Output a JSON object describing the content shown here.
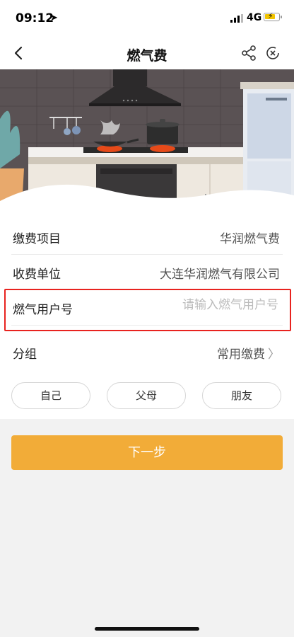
{
  "status": {
    "time": "09:12",
    "network": "4G"
  },
  "nav": {
    "title": "燃气费"
  },
  "form": {
    "item_label": "缴费项目",
    "item_value": "华润燃气费",
    "unit_label": "收费单位",
    "unit_value": "大连华润燃气有限公司",
    "account_label": "燃气用户号",
    "account_placeholder": "请输入燃气用户号",
    "group_label": "分组",
    "group_value": "常用缴费",
    "chips": [
      "自己",
      "父母",
      "朋友"
    ]
  },
  "actions": {
    "next_label": "下一步"
  },
  "colors": {
    "accent": "#f2ac38",
    "highlight": "#e8231f"
  }
}
